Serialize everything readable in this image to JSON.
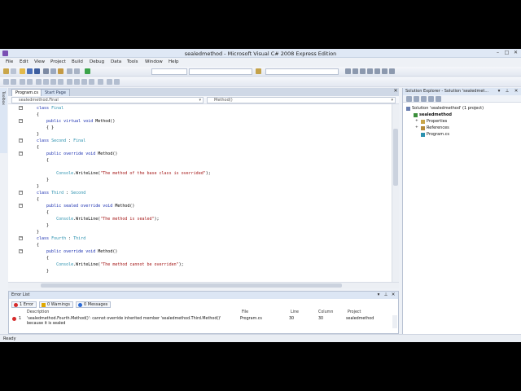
{
  "window": {
    "title": "sealedmethod - Microsoft Visual C# 2008 Express Edition",
    "controls": {
      "minimize": "–",
      "maximize": "□",
      "close": "✕"
    }
  },
  "menu": [
    "File",
    "Edit",
    "View",
    "Project",
    "Build",
    "Debug",
    "Data",
    "Tools",
    "Window",
    "Help"
  ],
  "editor": {
    "tabs": [
      {
        "label": "Program.cs",
        "active": true
      },
      {
        "label": "Start Page",
        "active": false
      }
    ],
    "close": "✕",
    "nav_left": "sealedmethod.Final",
    "nav_right": "Method()",
    "code": [
      [
        {
          "t": "class ",
          "c": "kw"
        },
        {
          "t": "Final",
          "c": "ty"
        }
      ],
      [
        {
          "t": "{",
          "c": "tx"
        }
      ],
      [
        {
          "t": "    public virtual void ",
          "c": "kw"
        },
        {
          "t": "Method()",
          "c": "tx"
        }
      ],
      [
        {
          "t": "    { }",
          "c": "tx"
        }
      ],
      [
        {
          "t": "}",
          "c": "tx"
        }
      ],
      [
        {
          "t": "class ",
          "c": "kw"
        },
        {
          "t": "Second",
          "c": "ty"
        },
        {
          "t": " : ",
          "c": "tx"
        },
        {
          "t": "Final",
          "c": "ty"
        }
      ],
      [
        {
          "t": "{",
          "c": "tx"
        }
      ],
      [
        {
          "t": "    public override void ",
          "c": "kw"
        },
        {
          "t": "Method()",
          "c": "tx"
        }
      ],
      [
        {
          "t": "    {",
          "c": "tx"
        }
      ],
      [
        {
          "t": "",
          "c": "tx"
        }
      ],
      [
        {
          "t": "        Console",
          "c": "ty"
        },
        {
          "t": ".WriteLine(",
          "c": "tx"
        },
        {
          "t": "\"The method of the base class is overrided\"",
          "c": "st"
        },
        {
          "t": ");",
          "c": "tx"
        }
      ],
      [
        {
          "t": "    }",
          "c": "tx"
        }
      ],
      [
        {
          "t": "}",
          "c": "tx"
        }
      ],
      [
        {
          "t": "class ",
          "c": "kw"
        },
        {
          "t": "Third",
          "c": "ty"
        },
        {
          "t": " : ",
          "c": "tx"
        },
        {
          "t": "Second",
          "c": "ty"
        }
      ],
      [
        {
          "t": "{",
          "c": "tx"
        }
      ],
      [
        {
          "t": "    public sealed override void ",
          "c": "kw"
        },
        {
          "t": "Method()",
          "c": "tx"
        }
      ],
      [
        {
          "t": "    {",
          "c": "tx"
        }
      ],
      [
        {
          "t": "        Console",
          "c": "ty"
        },
        {
          "t": ".WriteLine(",
          "c": "tx"
        },
        {
          "t": "\"The method is sealed\"",
          "c": "st"
        },
        {
          "t": ");",
          "c": "tx"
        }
      ],
      [
        {
          "t": "    }",
          "c": "tx"
        }
      ],
      [
        {
          "t": "}",
          "c": "tx"
        }
      ],
      [
        {
          "t": "class ",
          "c": "kw"
        },
        {
          "t": "Fourth",
          "c": "ty"
        },
        {
          "t": " : ",
          "c": "tx"
        },
        {
          "t": "Third",
          "c": "ty"
        }
      ],
      [
        {
          "t": "{",
          "c": "tx"
        }
      ],
      [
        {
          "t": "    public override void ",
          "c": "kw"
        },
        {
          "t": "Method()",
          "c": "tx"
        }
      ],
      [
        {
          "t": "    {",
          "c": "tx"
        }
      ],
      [
        {
          "t": "        Console",
          "c": "ty"
        },
        {
          "t": ".WriteLine(",
          "c": "tx"
        },
        {
          "t": "\"The method cannot be overriden\"",
          "c": "st"
        },
        {
          "t": ");",
          "c": "tx"
        }
      ],
      [
        {
          "t": "    }",
          "c": "tx"
        }
      ]
    ]
  },
  "error_list": {
    "title": "Error List",
    "filters": {
      "errors": "1 Error",
      "warnings": "0 Warnings",
      "messages": "0 Messages"
    },
    "columns": {
      "description": "Description",
      "file": "File",
      "line": "Line",
      "column": "Column",
      "project": "Project"
    },
    "rows": [
      {
        "num": "1",
        "description": "'sealedmethod.Fourth.Method()': cannot override inherited member 'sealedmethod.Third.Method()'",
        "description_cont": "because it is sealed",
        "file": "Program.cs",
        "line": "30",
        "column": "30",
        "project": "sealedmethod"
      }
    ]
  },
  "solution_explorer": {
    "title": "Solution Explorer - Solution 'sealedmet...",
    "items": [
      {
        "label": "Solution 'sealedmethod' (1 project)",
        "bold": false,
        "indent": 0
      },
      {
        "label": "sealedmethod",
        "bold": true,
        "indent": 1
      },
      {
        "label": "Properties",
        "bold": false,
        "indent": 2
      },
      {
        "label": "References",
        "bold": false,
        "indent": 2
      },
      {
        "label": "Program.cs",
        "bold": false,
        "indent": 2
      }
    ]
  },
  "left_strip_label": "Toolbox",
  "status": "Ready",
  "colors": {
    "keyword": "#1a2fb0",
    "type": "#2b91af",
    "string": "#a31515",
    "error": "#d62b2b",
    "warning": "#e0a800",
    "info": "#2a6ad6"
  }
}
